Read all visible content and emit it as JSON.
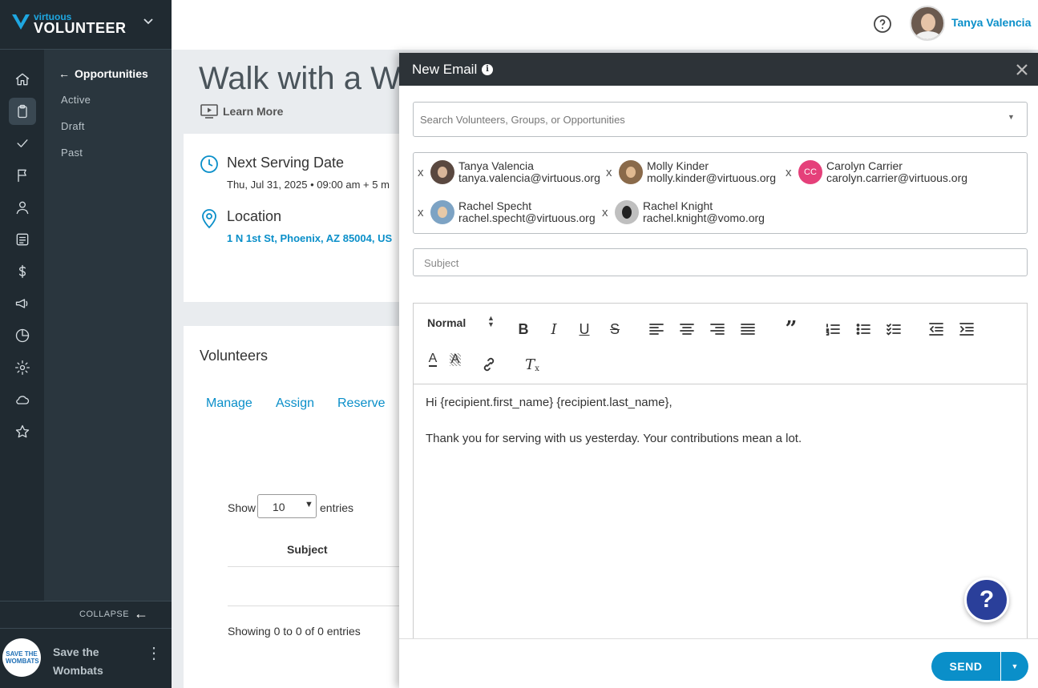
{
  "brand": {
    "top": "virtuous",
    "bottom": "VOLUNTEER"
  },
  "user": {
    "name": "Tanya Valencia"
  },
  "subnav": {
    "back_label": "Opportunities",
    "items": [
      "Active",
      "Draft",
      "Past"
    ]
  },
  "collapse_label": "COLLAPSE",
  "org": {
    "name_line1": "Save the",
    "name_line2": "Wombats",
    "logo_text": "SAVE THE WOMBATS"
  },
  "page": {
    "title": "Walk with a Wo",
    "learn_more": "Learn More",
    "next_serving_label": "Next Serving Date",
    "next_serving_value": "Thu, Jul 31, 2025 • 09:00 am + 5 m",
    "location_label": "Location",
    "location_value": "1 N 1st St, Phoenix, AZ 85004, US",
    "volunteers_heading": "Volunteers",
    "tabs": [
      "Manage",
      "Assign",
      "Reserve"
    ],
    "show_label": "Show",
    "entries_value": "10",
    "entries_label": "entries",
    "col_subject": "Subject",
    "showing_text": "Showing 0 to 0 of 0 entries"
  },
  "email": {
    "title": "New Email",
    "search_placeholder": "Search Volunteers, Groups, or Opportunities",
    "recipients": [
      {
        "name": "Tanya Valencia",
        "email": "tanya.valencia@virtuous.org",
        "initials": ""
      },
      {
        "name": "Molly Kinder",
        "email": "molly.kinder@virtuous.org",
        "initials": ""
      },
      {
        "name": "Carolyn Carrier",
        "email": "carolyn.carrier@virtuous.org",
        "initials": "CC"
      },
      {
        "name": "Rachel Specht",
        "email": "rachel.specht@virtuous.org",
        "initials": ""
      },
      {
        "name": "Rachel Knight",
        "email": "rachel.knight@vomo.org",
        "initials": ""
      }
    ],
    "remove_glyph": "x",
    "subject_placeholder": "Subject",
    "format_select": "Normal",
    "body_line1": "Hi {recipient.first_name} {recipient.last_name},",
    "body_line2": "Thank you for serving with us yesterday. Your contributions mean a lot.",
    "send_label": "SEND"
  },
  "colors": {
    "accent": "#0a8fc9",
    "nav_bg": "#202a31",
    "help_bubble": "#2a3f9a"
  }
}
